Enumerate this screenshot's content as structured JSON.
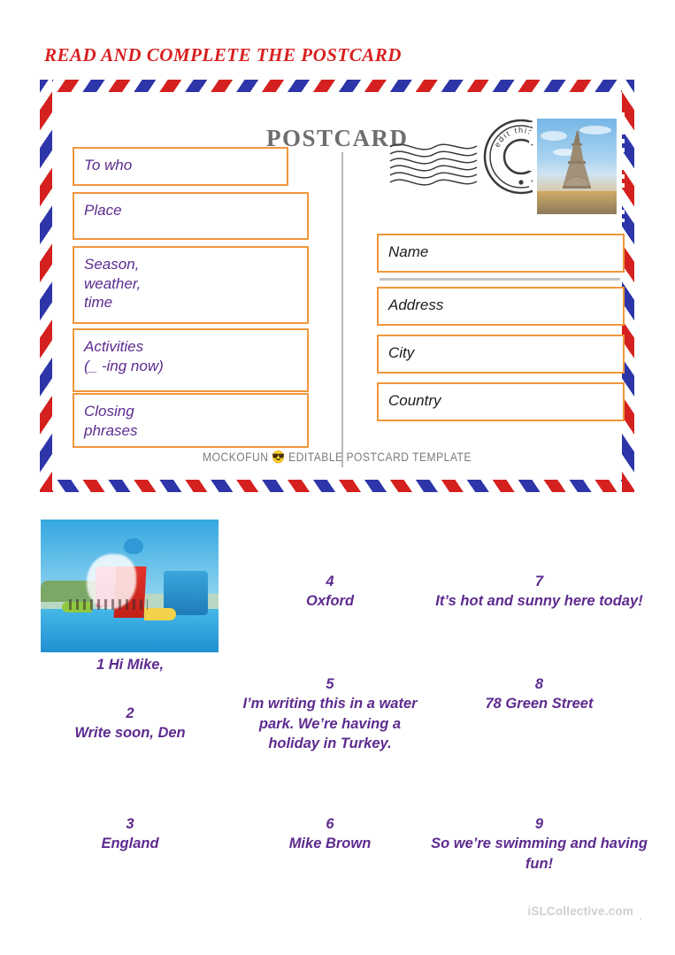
{
  "worksheet": {
    "title": "READ AND COMPLETE THE POSTCARD",
    "title_color": "#d81f20",
    "accent_purple": "#5d2b8f",
    "field_border": "#f0963c",
    "watermark": "iSLCollective.com",
    "watermark_dot": "."
  },
  "postcard": {
    "heading": "POSTCARD",
    "heading_color": "#6e6e6e",
    "footer": "MOCKOFUN",
    "footer_emoji": "😎",
    "footer_rest": "EDITABLE POSTCARD TEMPLATE",
    "stamp": {
      "icon": "eiffel-tower-stamp",
      "postmark_text": "edit this text online"
    },
    "message_fields": [
      {
        "key": "to_who",
        "label": "To who"
      },
      {
        "key": "place",
        "label": "Place"
      },
      {
        "key": "season",
        "label": "Season,\nweather,\ntime"
      },
      {
        "key": "activities",
        "label": "Activities\n(_ -ing now)"
      },
      {
        "key": "closing",
        "label": "Closing\nphrases"
      }
    ],
    "address_fields": [
      {
        "key": "name",
        "label": "Name"
      },
      {
        "key": "address",
        "label": "Address"
      },
      {
        "key": "city",
        "label": "City"
      },
      {
        "key": "country",
        "label": "Country"
      }
    ]
  },
  "exercise": {
    "photo_alt": "water-park-photo",
    "items": [
      {
        "num": "1",
        "text": "Hi Mike,",
        "inline": true
      },
      {
        "num": "2",
        "text": "Write soon, Den",
        "inline": false
      },
      {
        "num": "3",
        "text": "England",
        "inline": false
      },
      {
        "num": "4",
        "text": "Oxford",
        "inline": false
      },
      {
        "num": "5",
        "text": "I’m writing this in a water park. We’re having a holiday in Turkey.",
        "inline": false
      },
      {
        "num": "6",
        "text": "Mike Brown",
        "inline": false
      },
      {
        "num": "7",
        "text": "It’s hot and sunny here today!",
        "inline": false
      },
      {
        "num": "8",
        "text": "78 Green Street",
        "inline": false
      },
      {
        "num": "9",
        "text": "So we’re swimming and having fun!",
        "inline": false
      }
    ]
  }
}
